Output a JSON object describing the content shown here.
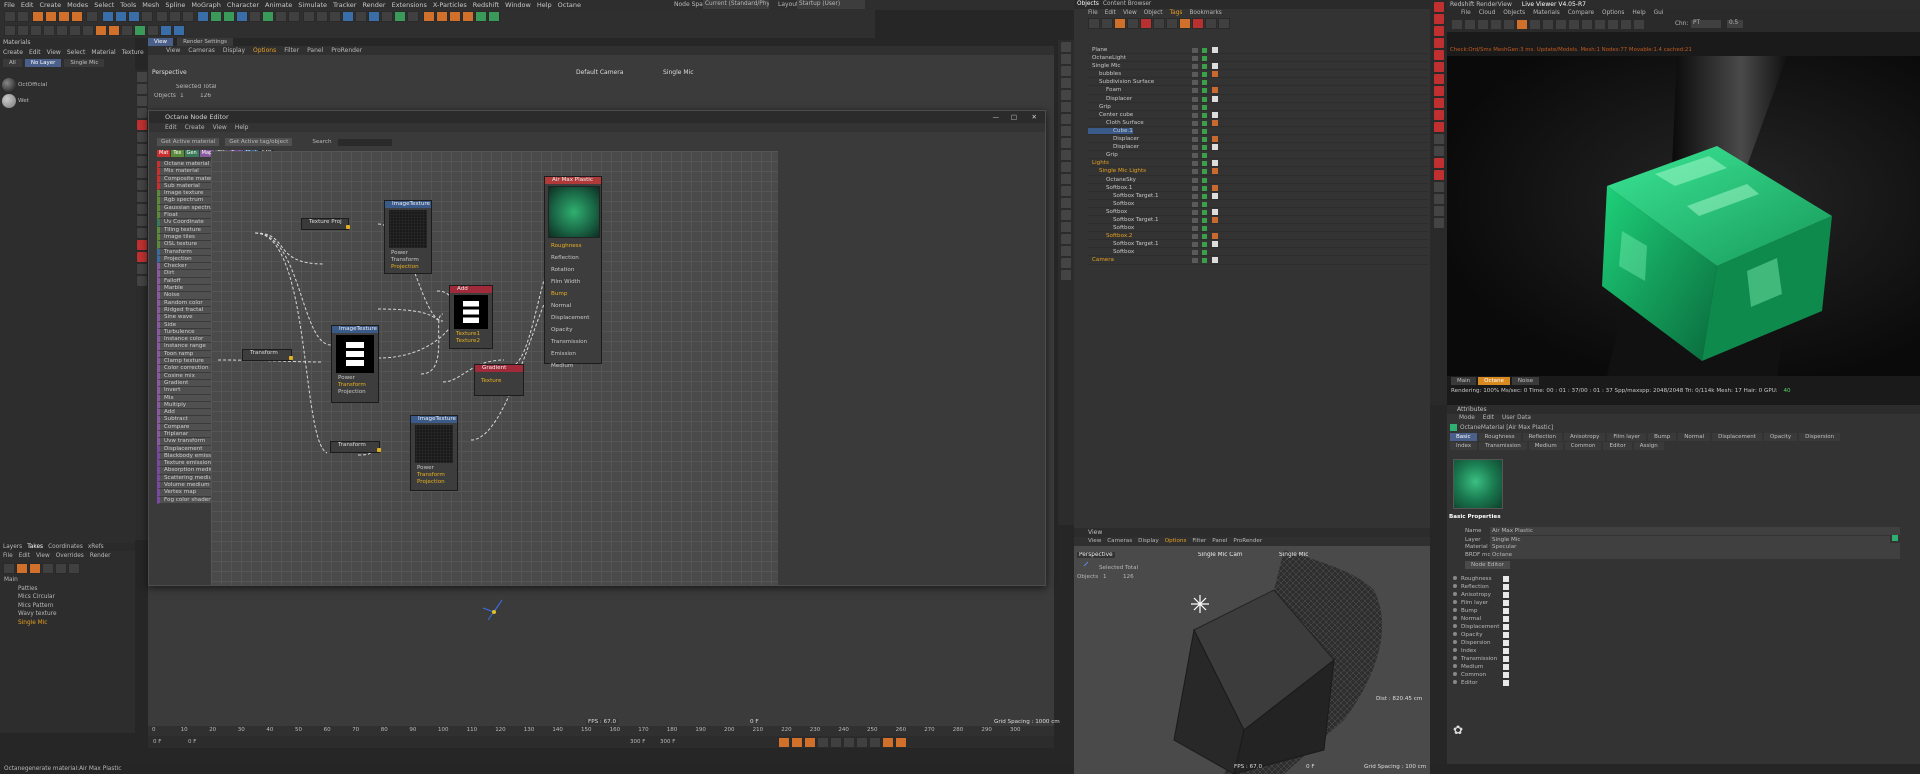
{
  "menubar": {
    "items": [
      "File",
      "Edit",
      "Create",
      "Modes",
      "Select",
      "Tools",
      "Mesh",
      "Spline",
      "MoGraph",
      "Character",
      "Animate",
      "Simulate",
      "Tracker",
      "Render",
      "Extensions",
      "X-Particles",
      "Redshift",
      "Window",
      "Help",
      "Octane"
    ],
    "node_space_label": "Node Space:",
    "node_space_value": "Current (Standard/Physical)",
    "layout_label": "Layout:",
    "layout_value": "Startup (User)"
  },
  "materials": {
    "title": "Materials",
    "menu": [
      "Create",
      "Edit",
      "View",
      "Select",
      "Material",
      "Texture"
    ],
    "tabs": [
      "All",
      "No Layer",
      "Single Mic"
    ],
    "items": [
      "OctOfficial",
      "Wet"
    ]
  },
  "viewport": {
    "menu": [
      "View",
      "Cameras",
      "Display",
      "Options",
      "Filter",
      "Panel",
      "ProRender"
    ],
    "tabs": [
      "View",
      "Render Settings"
    ],
    "label": "Perspective",
    "camera": "Default Camera",
    "layer": "Single Mic",
    "stats_header": "Selected Total",
    "stats_label": "Objects",
    "stats_values": [
      "1",
      "126"
    ],
    "fps": "FPS : 67.0",
    "frame": "0 F",
    "grid": "Grid Spacing : 1000 cm"
  },
  "node_editor": {
    "title": "Octane Node Editor",
    "menu": [
      "Edit",
      "Create",
      "View",
      "Help"
    ],
    "btn_get_material": "Get Active material",
    "btn_get_tag": "Get Active tag/object",
    "search_label": "Search",
    "cats": [
      "Mat",
      "Tex",
      "Gen",
      "Map",
      "Oth",
      "Emi",
      "Med",
      "C4D"
    ],
    "cat_colors": [
      "#c83030",
      "#5a8a3a",
      "#3a7a5a",
      "#8a5aa0",
      "#606060",
      "#7a4aa0",
      "#3a6aa0",
      "#202020"
    ],
    "library": [
      "Octane material",
      "Mix material",
      "Composite material",
      "Sub material",
      "Image texture",
      "Rgb spectrum",
      "Gaussian spectrum",
      "Float",
      "Uv Coordinate",
      "Tiling texture",
      "Image tiles",
      "OSL texture",
      "Transform",
      "Projection",
      "Checker",
      "Dirt",
      "Falloff",
      "Marble",
      "Noise",
      "Random color",
      "Ridged fractal",
      "Sine wave",
      "Side",
      "Turbulence",
      "Instance color",
      "Instance range",
      "Toon ramp",
      "Clamp texture",
      "Color correction",
      "Cosine mix",
      "Gradient",
      "Invert",
      "Mix",
      "Multiply",
      "Add",
      "Subtract",
      "Compare",
      "Triplanar",
      "Uvw transform",
      "Displacement",
      "Blackbody emission",
      "Texture emission",
      "Absorption medium",
      "Scattering medium",
      "Volume medium",
      "Vertex map",
      "Fog color shader"
    ],
    "nodes": {
      "texture_proj": "Texture Proj",
      "transform1": "Transform",
      "transform2": "Transform",
      "img1": {
        "title": "ImageTexture",
        "params": [
          "Power",
          "Transform",
          "Projection"
        ]
      },
      "img2": {
        "title": "ImageTexture",
        "params": [
          "Power",
          "Transform",
          "Projection"
        ]
      },
      "img3": {
        "title": "ImageTexture",
        "params": [
          "Power",
          "Transform",
          "Projection"
        ]
      },
      "add": {
        "title": "Add",
        "params": [
          "Texture1",
          "Texture2"
        ]
      },
      "gradient": {
        "title": "Gradient",
        "params": [
          "Texture"
        ]
      },
      "material": {
        "title": "Air Max Plastic",
        "params": [
          "Roughness",
          "Reflection",
          "Rotation",
          "Film Width",
          "Bump",
          "Normal",
          "Displacement",
          "Opacity",
          "Transmission",
          "Emission",
          "Medium"
        ]
      }
    }
  },
  "layers": {
    "tabs": [
      "Layers",
      "Takes",
      "Coordinates",
      "xRefs"
    ],
    "menu": [
      "File",
      "Edit",
      "View",
      "Overrides",
      "Render"
    ],
    "items": [
      "Main",
      "Patties",
      "Mics Circular",
      "Mics Pattern",
      "Wavy texture",
      "Single Mic"
    ]
  },
  "timeline": {
    "ticks": [
      "0",
      "10",
      "20",
      "30",
      "40",
      "50",
      "60",
      "70",
      "80",
      "90",
      "100",
      "110",
      "120",
      "130",
      "140",
      "150",
      "160",
      "170",
      "180",
      "190",
      "200",
      "210",
      "220",
      "230",
      "240",
      "250",
      "260",
      "270",
      "280",
      "290",
      "300"
    ],
    "start": "0 F",
    "end_a": "300 F",
    "end_b": "300 F",
    "cur": "0 F"
  },
  "statusbar": {
    "text": "Octanegenerate material:Air Max Plastic"
  },
  "objects": {
    "tabs": [
      "Objects",
      "Content Browser"
    ],
    "menu": [
      "File",
      "Edit",
      "View",
      "Object",
      "Tags",
      "Bookmarks"
    ],
    "items": [
      "Plane",
      "OctaneLight",
      "Single Mic",
      "bubbles",
      "Subdivision Surface",
      "Foam",
      "Displacer",
      "Grip",
      "Center cube",
      "Cloth Surface",
      "Cube.1",
      "Displacer",
      "Displacer",
      "Grip",
      "Lights",
      "Single Mic Lights",
      "OctaneSky",
      "Softbox.1",
      "Softbox Target.1",
      "Softbox",
      "Softbox",
      "Softbox Target.1",
      "Softbox",
      "Softbox.2",
      "Softbox Target.1",
      "Softbox",
      "Camera"
    ],
    "indent": [
      0,
      0,
      0,
      1,
      1,
      2,
      2,
      1,
      1,
      2,
      3,
      3,
      3,
      2,
      0,
      1,
      2,
      2,
      3,
      3,
      2,
      3,
      3,
      2,
      3,
      3,
      0
    ]
  },
  "view2": {
    "title": "View",
    "menu": [
      "View",
      "Cameras",
      "Display",
      "Options",
      "Filter",
      "Panel",
      "ProRender"
    ],
    "label": "Perspective",
    "camera": "Single Mic Cam",
    "layer": "Single Mic",
    "stats_header": "Selected Total",
    "stats_label": "Objects",
    "stats_values": [
      "1",
      "126"
    ],
    "dist": "Dist : 820.45 cm",
    "fps": "FPS : 67.0",
    "frame": "0 F",
    "grid": "Grid Spacing : 100 cm"
  },
  "live_viewer": {
    "title": "Live Viewer V4.05-R7",
    "app": "Redshift RenderView",
    "menu": [
      "File",
      "Cloud",
      "Objects",
      "Materials",
      "Compare",
      "Options",
      "Help",
      "Gui"
    ],
    "channel": "Chn:",
    "channel_value": "PT",
    "zoom": "0.5",
    "warning": "Check:Ord/Sms MeshGen:3 ms. Update/Models. Mesh:1 Nodes:77 Movable:1.4 cached:21",
    "tabs": [
      "Main",
      "Octane",
      "Noise"
    ],
    "status": "Rendering: 100%  Ms/sec: 0   Time: 00 : 01 : 37/00 : 01 : 37   Spp/maxspp: 2048/2048   Tri: 0/114k   Mesh: 17   Hair: 0   GPU:",
    "gpu": "40"
  },
  "attributes": {
    "title": "Attributes",
    "menu": [
      "Mode",
      "Edit",
      "User Data"
    ],
    "material": "OctaneMaterial [Air Max Plastic]",
    "tabs": [
      "Basic",
      "Roughness",
      "Reflection",
      "Anisotropy",
      "Film layer",
      "Bump",
      "Normal",
      "Displacement",
      "Opacity",
      "Dispersion",
      "Index",
      "Transmission",
      "Medium",
      "Common",
      "Editor",
      "Assign"
    ],
    "section": "Basic Properties",
    "name_label": "Name",
    "name_value": "Air Max Plastic",
    "layer_label": "Layer",
    "layer_value": "Single Mic",
    "mattype_label": "Material type",
    "mattype_value": "Specular",
    "brdf_label": "BRDF model",
    "brdf_value": "Octane",
    "node_editor_btn": "Node Editor",
    "checks": [
      "Roughness",
      "Reflection",
      "Anisotropy",
      "Film layer",
      "Bump",
      "Normal",
      "Displacement",
      "Opacity",
      "Dispersion",
      "Index",
      "Transmission",
      "Medium",
      "Common",
      "Editor"
    ]
  }
}
